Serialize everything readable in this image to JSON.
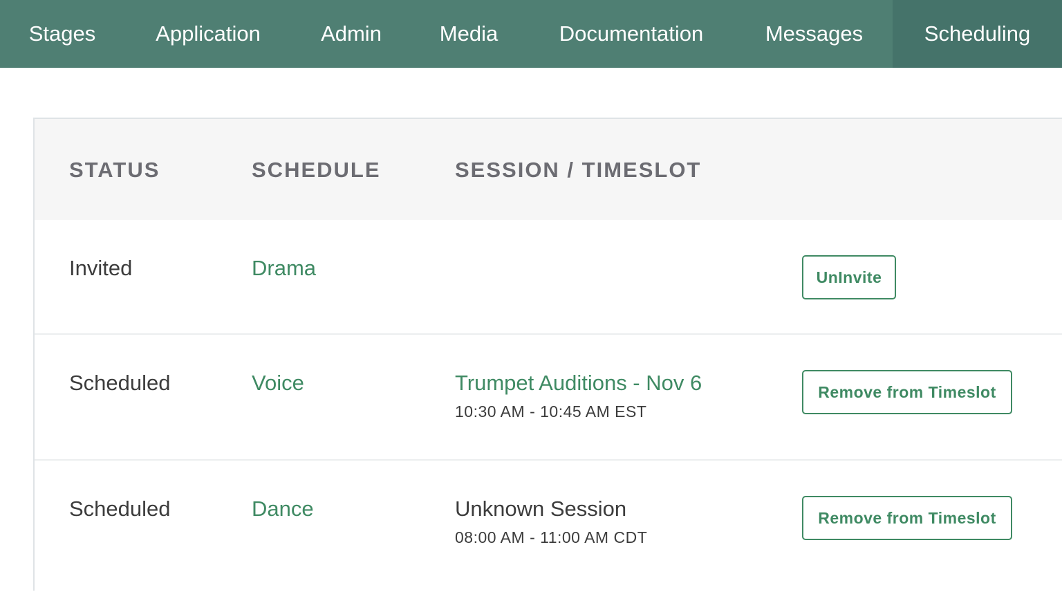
{
  "nav": {
    "tabs": [
      {
        "label": "Stages",
        "active": false
      },
      {
        "label": "Application",
        "active": false
      },
      {
        "label": "Admin",
        "active": false
      },
      {
        "label": "Media",
        "active": false
      },
      {
        "label": "Documentation",
        "active": false
      },
      {
        "label": "Messages",
        "active": false
      },
      {
        "label": "Scheduling",
        "active": true
      }
    ]
  },
  "table": {
    "headers": {
      "status": "STATUS",
      "schedule": "SCHEDULE",
      "session": "SESSION / TIMESLOT"
    },
    "rows": [
      {
        "status": "Invited",
        "schedule": "Drama",
        "session": "",
        "timeslot": "",
        "action": "UnInvite"
      },
      {
        "status": "Scheduled",
        "schedule": "Voice",
        "session": "Trumpet Auditions - Nov 6",
        "timeslot": "10:30 AM - 10:45 AM EST",
        "action": "Remove from Timeslot"
      },
      {
        "status": "Scheduled",
        "schedule": "Dance",
        "session": "Unknown Session",
        "timeslot": "08:00 AM - 11:00 AM CDT",
        "action": "Remove from Timeslot"
      }
    ]
  },
  "colors": {
    "nav_bg": "#4f7f73",
    "nav_active_bg": "#45736a",
    "accent_green": "#3f8a63",
    "header_bg": "#f6f6f6"
  }
}
